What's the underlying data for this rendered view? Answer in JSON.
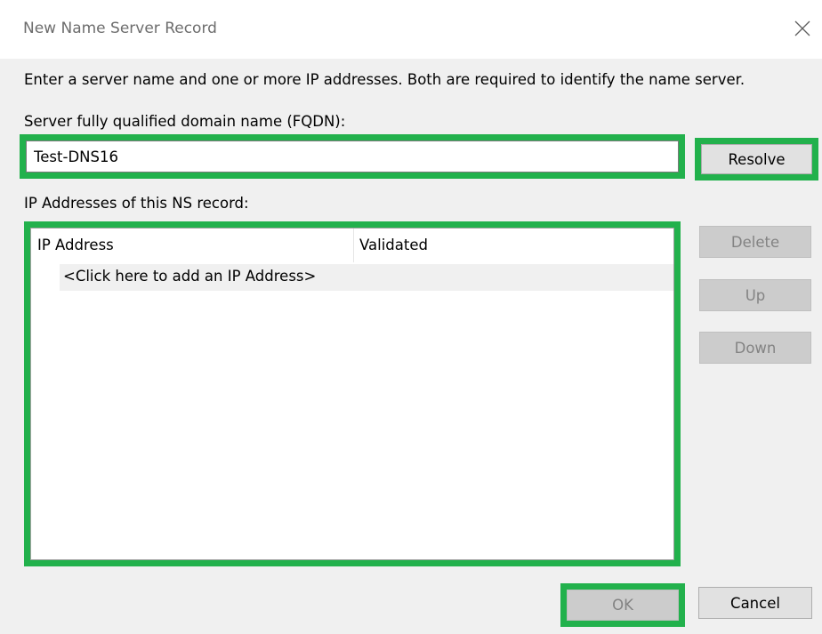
{
  "window": {
    "title": "New Name Server Record",
    "close_icon": "close-icon"
  },
  "form": {
    "instructions": "Enter a server name and one or more IP addresses.  Both are required to identify the name server.",
    "fqdn_label": "Server fully qualified domain name (FQDN):",
    "fqdn_value": "Test-DNS16",
    "resolve_label": "Resolve",
    "ip_list_label": "IP Addresses of this NS record:"
  },
  "ip_table": {
    "columns": [
      "IP Address",
      "Validated"
    ],
    "add_prompt": "<Click here to add an IP Address>"
  },
  "side_buttons": {
    "delete_label": "Delete",
    "up_label": "Up",
    "down_label": "Down"
  },
  "footer": {
    "ok_label": "OK",
    "cancel_label": "Cancel"
  },
  "colors": {
    "highlight": "#22b14c",
    "disabled_text": "#838383"
  }
}
